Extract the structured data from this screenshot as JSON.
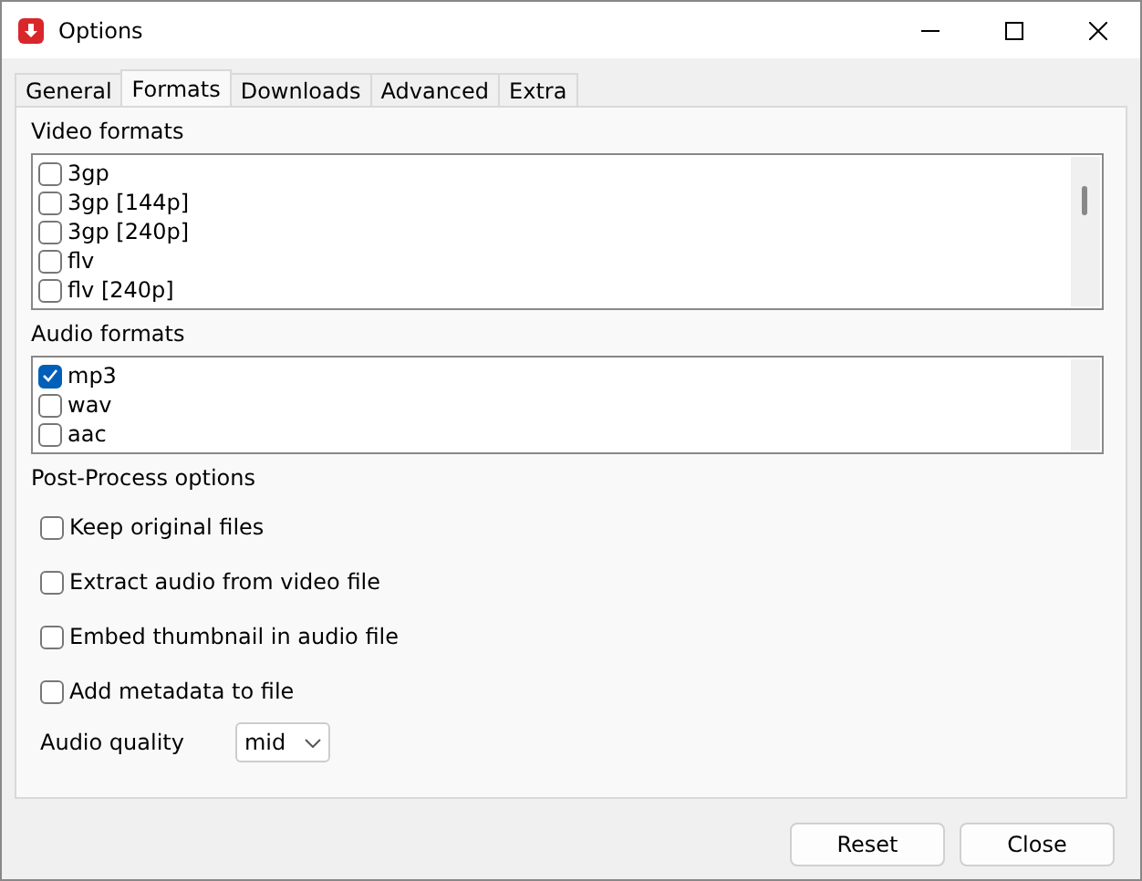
{
  "window": {
    "title": "Options"
  },
  "tabs": [
    {
      "label": "General",
      "selected": false
    },
    {
      "label": "Formats",
      "selected": true
    },
    {
      "label": "Downloads",
      "selected": false
    },
    {
      "label": "Advanced",
      "selected": false
    },
    {
      "label": "Extra",
      "selected": false
    }
  ],
  "video_formats": {
    "label": "Video formats",
    "items": [
      {
        "label": "3gp",
        "checked": false
      },
      {
        "label": "3gp [144p]",
        "checked": false
      },
      {
        "label": "3gp [240p]",
        "checked": false
      },
      {
        "label": "flv",
        "checked": false
      },
      {
        "label": "flv [240p]",
        "checked": false
      }
    ]
  },
  "audio_formats": {
    "label": "Audio formats",
    "items": [
      {
        "label": "mp3",
        "checked": true
      },
      {
        "label": "wav",
        "checked": false
      },
      {
        "label": "aac",
        "checked": false
      }
    ]
  },
  "post_process": {
    "label": "Post-Process options",
    "options": [
      {
        "label": "Keep original files",
        "checked": false
      },
      {
        "label": "Extract audio from video file",
        "checked": false
      },
      {
        "label": "Embed thumbnail in audio file",
        "checked": false
      },
      {
        "label": "Add metadata to file",
        "checked": false
      }
    ]
  },
  "audio_quality": {
    "label": "Audio quality",
    "value": "mid"
  },
  "buttons": [
    "Reset",
    "Close"
  ]
}
